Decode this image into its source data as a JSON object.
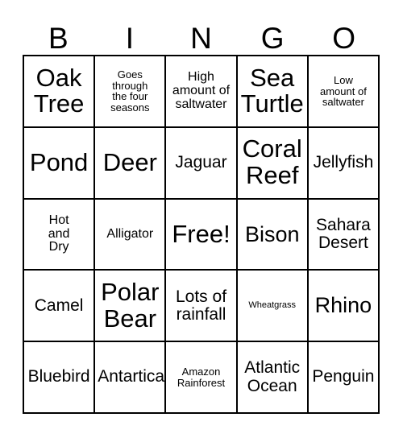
{
  "card": {
    "header_letters": [
      "B",
      "I",
      "N",
      "G",
      "O"
    ],
    "rows": [
      [
        {
          "text": "Oak\nTree",
          "size": "xl"
        },
        {
          "text": "Goes\nthrough\nthe four\nseasons",
          "size": "xs"
        },
        {
          "text": "High\namount of\nsaltwater",
          "size": "sm"
        },
        {
          "text": "Sea\nTurtle",
          "size": "xl"
        },
        {
          "text": "Low\namount of\nsaltwater",
          "size": "xs"
        }
      ],
      [
        {
          "text": "Pond",
          "size": "xl"
        },
        {
          "text": "Deer",
          "size": "xl"
        },
        {
          "text": "Jaguar",
          "size": "md"
        },
        {
          "text": "Coral\nReef",
          "size": "xl"
        },
        {
          "text": "Jellyfish",
          "size": "md"
        }
      ],
      [
        {
          "text": "Hot\nand\nDry",
          "size": "sm"
        },
        {
          "text": "Alligator",
          "size": "sm"
        },
        {
          "text": "Free!",
          "size": "xl"
        },
        {
          "text": "Bison",
          "size": "lg"
        },
        {
          "text": "Sahara\nDesert",
          "size": "md"
        }
      ],
      [
        {
          "text": "Camel",
          "size": "md"
        },
        {
          "text": "Polar\nBear",
          "size": "xl"
        },
        {
          "text": "Lots of\nrainfall",
          "size": "md"
        },
        {
          "text": "Wheatgrass",
          "size": "xxs"
        },
        {
          "text": "Rhino",
          "size": "lg"
        }
      ],
      [
        {
          "text": "Bluebird",
          "size": "md"
        },
        {
          "text": "Antartica",
          "size": "md"
        },
        {
          "text": "Amazon\nRainforest",
          "size": "xs"
        },
        {
          "text": "Atlantic\nOcean",
          "size": "md"
        },
        {
          "text": "Penguin",
          "size": "md"
        }
      ]
    ]
  }
}
